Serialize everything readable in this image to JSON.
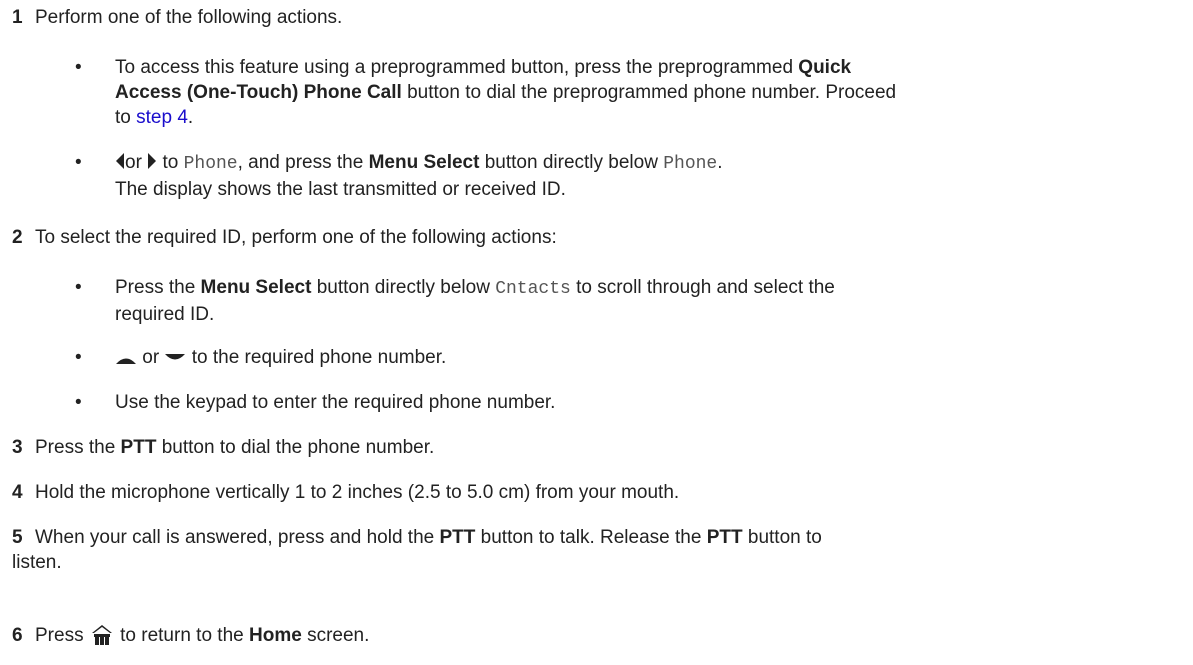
{
  "steps": {
    "s1": {
      "num": "1",
      "text": "Perform one of the following actions.",
      "b1": {
        "line1_pre": "To access this feature using a preprogrammed button, press the preprogrammed ",
        "line1_bold": "Quick",
        "line2_bold": "Access (One-Touch) Phone Call",
        "line2_post": " button to dial the preprogrammed phone number. Proceed",
        "line3_pre": "to ",
        "link": "step 4",
        "line3_post": "."
      },
      "b2": {
        "or": "or",
        "to": " to ",
        "mono1": "Phone",
        "mid": ", and press the ",
        "bold": "Menu Select",
        "post": " button directly below ",
        "mono2": "Phone",
        "end": ".",
        "line2": "The display shows the last transmitted or received ID."
      }
    },
    "s2": {
      "num": "2",
      "text": "To select the required ID, perform one of the following actions:",
      "b1": {
        "pre": "Press the ",
        "bold": "Menu Select",
        "mid": " button directly below ",
        "mono": "Cntacts",
        "post": " to scroll through and select the",
        "line2": "required ID."
      },
      "b2": {
        "or": " or ",
        "post": " to the required phone number."
      },
      "b3": {
        "text": "Use the keypad to enter the required phone number."
      }
    },
    "s3": {
      "num": "3",
      "pre": "Press the ",
      "bold": "PTT",
      "post": " button to dial the phone number."
    },
    "s4": {
      "num": "4",
      "text": "Hold the microphone vertically 1 to 2 inches (2.5 to 5.0 cm) from your mouth."
    },
    "s5": {
      "num": "5",
      "pre": "When your call is answered, press and hold the ",
      "bold1": "PTT",
      "mid": " button to talk. Release the ",
      "bold2": "PTT",
      "post": " button to",
      "line2": "listen."
    },
    "s6": {
      "num": "6",
      "pre": "Press ",
      "mid": " to return to the ",
      "bold": "Home",
      "post": " screen."
    }
  },
  "icons": {
    "left": "left-arrow-icon",
    "right": "right-arrow-icon",
    "up": "up-arrow-icon",
    "down": "down-arrow-icon",
    "home": "home-icon"
  },
  "colors": {
    "text": "#222222",
    "link": "#1a0dcc",
    "mono": "#555555"
  }
}
